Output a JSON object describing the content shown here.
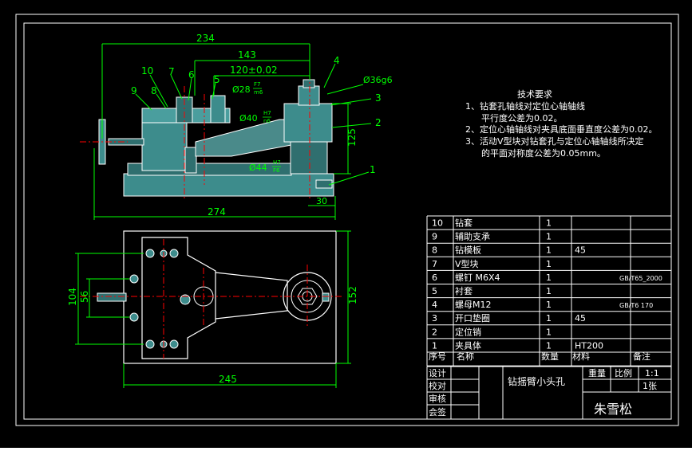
{
  "colors": {
    "background": "#000000",
    "frame": "#ffffff",
    "dimension": "#00ff00",
    "outline": "#ffffff",
    "part": "#3d8c8c",
    "centerline": "#ff0000",
    "leader": "#00ffff"
  },
  "front_view": {
    "dims": {
      "d234": "234",
      "d143": "143",
      "d120": "120±0.02",
      "d274": "274",
      "d30": "30",
      "d125": "125",
      "fit28_d": "Ø28",
      "fit28_u": "F7",
      "fit28_l": "m6",
      "fit40_d": "Ø40",
      "fit40_u": "H7",
      "fit40_l": "n6",
      "fit44_d": "Ø44",
      "fit44_u": "H7",
      "fit44_l": "F6",
      "d36": "Ø36g6"
    },
    "balloons": [
      "1",
      "2",
      "3",
      "4",
      "5",
      "6",
      "7",
      "8",
      "9",
      "10"
    ]
  },
  "top_view": {
    "dims": {
      "d245": "245",
      "d152": "152",
      "d104": "104",
      "d56": "56"
    }
  },
  "tech_req": {
    "title": "技术要求",
    "lines": [
      "1、钻套孔轴线对定位心轴轴线",
      "平行度公差为0.02。",
      "2、定位心轴轴线对夹具底面垂直度公差为0.02。",
      "3、活动V型块对钻套孔与定位心轴轴线所决定",
      "的平面对称度公差为0.05mm。"
    ]
  },
  "bom": {
    "rows": [
      {
        "no": "10",
        "name": "钻套",
        "qty": "1",
        "material": "",
        "note": ""
      },
      {
        "no": "9",
        "name": "辅助支承",
        "qty": "1",
        "material": "",
        "note": ""
      },
      {
        "no": "8",
        "name": "钻模板",
        "qty": "1",
        "material": "45",
        "note": ""
      },
      {
        "no": "7",
        "name": "V型块",
        "qty": "1",
        "material": "",
        "note": ""
      },
      {
        "no": "6",
        "name": "螺钉 M6X4",
        "qty": "1",
        "material": "",
        "note": "GB/T65_2000"
      },
      {
        "no": "5",
        "name": "衬套",
        "qty": "1",
        "material": "",
        "note": ""
      },
      {
        "no": "4",
        "name": "螺母M12",
        "qty": "1",
        "material": "",
        "note": "GB/T6 170"
      },
      {
        "no": "3",
        "name": "开口垫圈",
        "qty": "1",
        "material": "45",
        "note": ""
      },
      {
        "no": "2",
        "name": "定位销",
        "qty": "1",
        "material": "",
        "note": ""
      },
      {
        "no": "1",
        "name": "夹具体",
        "qty": "1",
        "material": "HT200",
        "note": ""
      }
    ],
    "header": {
      "no": "序号",
      "name": "名称",
      "qty": "数量",
      "material": "材料",
      "note": "备注"
    }
  },
  "title_block": {
    "roles": [
      "设计",
      "校对",
      "审核",
      "会签"
    ],
    "drawing_name": "钻摇臂小头孔",
    "weight_label": "重量",
    "scale_label": "比例",
    "scale_value": "1:1",
    "sheet": "1张",
    "author": "朱雪松"
  }
}
